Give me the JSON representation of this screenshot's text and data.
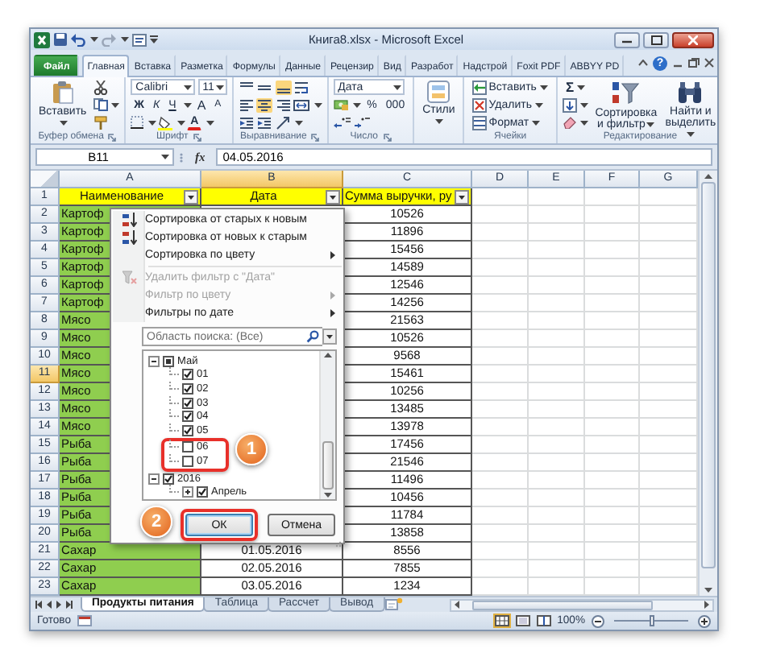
{
  "window": {
    "title": "Книга8.xlsx - Microsoft Excel"
  },
  "ribbon_tabs": [
    {
      "label": "Файл",
      "kind": "file",
      "selected": false
    },
    {
      "label": "Главная",
      "kind": "tab",
      "selected": true
    },
    {
      "label": "Вставка",
      "kind": "tab",
      "selected": false
    },
    {
      "label": "Разметка",
      "kind": "tab",
      "selected": false
    },
    {
      "label": "Формулы",
      "kind": "tab",
      "selected": false
    },
    {
      "label": "Данные",
      "kind": "tab",
      "selected": false
    },
    {
      "label": "Рецензир",
      "kind": "tab",
      "selected": false
    },
    {
      "label": "Вид",
      "kind": "tab",
      "selected": false
    },
    {
      "label": "Разработ",
      "kind": "tab",
      "selected": false
    },
    {
      "label": "Надстрой",
      "kind": "tab",
      "selected": false
    },
    {
      "label": "Foxit PDF",
      "kind": "tab",
      "selected": false
    },
    {
      "label": "ABBYY PD",
      "kind": "tab",
      "selected": false
    }
  ],
  "help": "?",
  "ribbon": {
    "clipboard": {
      "label": "Буфер обмена",
      "paste": "Вставить"
    },
    "font": {
      "label": "Шрифт",
      "name": "Calibri",
      "size": "11",
      "styles": [
        "Ж",
        "К",
        "Ч"
      ],
      "resize": [
        "A",
        "A"
      ],
      "color_button": "A"
    },
    "alignment": {
      "label": "Выравнивание",
      "buttons": [
        {
          "kind": "top",
          "selected": false
        },
        {
          "kind": "middle",
          "selected": false
        },
        {
          "kind": "bottom",
          "selected": true
        },
        {
          "kind": "wrap",
          "selected": false
        },
        {
          "kind": "left",
          "selected": false
        },
        {
          "kind": "center",
          "selected": true
        },
        {
          "kind": "right",
          "selected": false
        },
        {
          "kind": "merge",
          "selected": false
        },
        {
          "kind": "indent_less",
          "selected": false
        },
        {
          "kind": "indent_more",
          "selected": false
        },
        {
          "kind": "orientation",
          "selected": false
        }
      ]
    },
    "number": {
      "label": "Число",
      "format": "Дата",
      "percent": "%",
      "thousands": "000"
    },
    "styles": {
      "button": "Стили"
    },
    "cells": {
      "label": "Ячейки",
      "buttons": [
        "Вставить",
        "Удалить",
        "Формат"
      ]
    },
    "editing": {
      "label": "Редактирование",
      "sigma": "Σ",
      "sort": "Сортировка и фильтр",
      "find": "Найти и выделить"
    }
  },
  "formula_bar": {
    "name_box": "B11",
    "function_button": "fx",
    "value": "04.05.2016"
  },
  "sheet": {
    "columns": [
      {
        "label": "A",
        "selected": false
      },
      {
        "label": "B",
        "selected": true
      },
      {
        "label": "C",
        "selected": false
      },
      {
        "label": "D",
        "selected": false
      },
      {
        "label": "E",
        "selected": false
      },
      {
        "label": "F",
        "selected": false
      },
      {
        "label": "G",
        "selected": false
      }
    ],
    "rows": [
      {
        "number": "1",
        "kind": "header",
        "selected": false,
        "a": "Наименование",
        "b": "Дата",
        "c": "Сумма выручки, ру"
      },
      {
        "number": "2",
        "kind": "data",
        "selected": false,
        "a": "Картоф",
        "c": "10526"
      },
      {
        "number": "3",
        "kind": "data",
        "selected": false,
        "a": "Картоф",
        "c": "11896"
      },
      {
        "number": "4",
        "kind": "data",
        "selected": false,
        "a": "Картоф",
        "c": "15456"
      },
      {
        "number": "5",
        "kind": "data",
        "selected": false,
        "a": "Картоф",
        "c": "14589"
      },
      {
        "number": "6",
        "kind": "data",
        "selected": false,
        "a": "Картоф",
        "c": "12546"
      },
      {
        "number": "7",
        "kind": "data",
        "selected": false,
        "a": "Картоф",
        "c": "14256"
      },
      {
        "number": "8",
        "kind": "data",
        "selected": false,
        "a": "Мясо",
        "c": "21563"
      },
      {
        "number": "9",
        "kind": "data",
        "selected": false,
        "a": "Мясо",
        "c": "10526"
      },
      {
        "number": "10",
        "kind": "data",
        "selected": false,
        "a": "Мясо",
        "c": "9568"
      },
      {
        "number": "11",
        "kind": "data",
        "selected": true,
        "a": "Мясо",
        "c": "15461"
      },
      {
        "number": "12",
        "kind": "data",
        "selected": false,
        "a": "Мясо",
        "c": "10256"
      },
      {
        "number": "13",
        "kind": "data",
        "selected": false,
        "a": "Мясо",
        "c": "13485"
      },
      {
        "number": "14",
        "kind": "data",
        "selected": false,
        "a": "Мясо",
        "c": "13978"
      },
      {
        "number": "15",
        "kind": "data",
        "selected": false,
        "a": "Рыба",
        "c": "17456"
      },
      {
        "number": "16",
        "kind": "data",
        "selected": false,
        "a": "Рыба",
        "c": "21546"
      },
      {
        "number": "17",
        "kind": "data",
        "selected": false,
        "a": "Рыба",
        "c": "11496"
      },
      {
        "number": "18",
        "kind": "data",
        "selected": false,
        "a": "Рыба",
        "c": "10456"
      },
      {
        "number": "19",
        "kind": "data",
        "selected": false,
        "a": "Рыба",
        "c": "11784"
      },
      {
        "number": "20",
        "kind": "data",
        "selected": false,
        "a": "Рыба",
        "c": "13858"
      },
      {
        "number": "21",
        "kind": "data",
        "selected": false,
        "a": "Сахар",
        "b": "01.05.2016",
        "c": "8556"
      },
      {
        "number": "22",
        "kind": "data",
        "selected": false,
        "a": "Сахар",
        "b": "02.05.2016",
        "c": "7855"
      },
      {
        "number": "23",
        "kind": "data",
        "selected": false,
        "a": "Сахар",
        "b": "03.05.2016",
        "c": "1234"
      }
    ]
  },
  "filter_menu": {
    "items": [
      {
        "label": "Сортировка от старых к новым",
        "kind": "sort_asc",
        "disabled": false,
        "submenu": false
      },
      {
        "label": "Сортировка от новых к старым",
        "kind": "sort_desc",
        "disabled": false,
        "submenu": false
      },
      {
        "label": "Сортировка по цвету",
        "kind": "plain",
        "disabled": false,
        "submenu": true
      },
      {
        "label": "Удалить фильтр с \"Дата\"",
        "kind": "clear_filter",
        "disabled": true,
        "submenu": false
      },
      {
        "label": "Фильтр по цвету",
        "kind": "plain",
        "disabled": true,
        "submenu": true
      },
      {
        "label": "Фильтры по дате",
        "kind": "plain",
        "disabled": false,
        "submenu": true
      }
    ],
    "search": {
      "placeholder": "Область поиска: (Все)"
    },
    "tree": [
      {
        "label": "Май",
        "expanded": true,
        "checked": false,
        "mixed": true,
        "children": [
          {
            "label": "01",
            "checked": true,
            "highlighted": false
          },
          {
            "label": "02",
            "checked": true,
            "highlighted": false
          },
          {
            "label": "03",
            "checked": true,
            "highlighted": false
          },
          {
            "label": "04",
            "checked": true,
            "highlighted": false
          },
          {
            "label": "05",
            "checked": true,
            "highlighted": false
          },
          {
            "label": "06",
            "checked": false,
            "highlighted": true
          },
          {
            "label": "07",
            "checked": false,
            "highlighted": true
          }
        ]
      },
      {
        "label": "2016",
        "expanded": true,
        "checked": true,
        "mixed": false,
        "children": [
          {
            "label": "Апрель",
            "expanded": false,
            "checked": true,
            "highlighted": false
          }
        ]
      }
    ],
    "buttons": [
      {
        "label": "ОК",
        "kind": "ok",
        "highlighted": true
      },
      {
        "label": "Отмена",
        "kind": "cancel",
        "highlighted": false
      }
    ],
    "callouts": [
      {
        "number": "1"
      },
      {
        "number": "2"
      }
    ]
  },
  "sheet_tabs": [
    {
      "label": "Продукты питания",
      "selected": true
    },
    {
      "label": "Таблица",
      "selected": false
    },
    {
      "label": "Рассчет",
      "selected": false
    },
    {
      "label": "Вывод",
      "selected": false
    }
  ],
  "status_bar": {
    "text": "Готово",
    "views": [
      {
        "kind": "normal",
        "selected": true
      },
      {
        "kind": "layout",
        "selected": false
      },
      {
        "kind": "page_break",
        "selected": false
      }
    ],
    "zoom": "100%",
    "zoom_slider": {
      "level": 0.5
    }
  }
}
